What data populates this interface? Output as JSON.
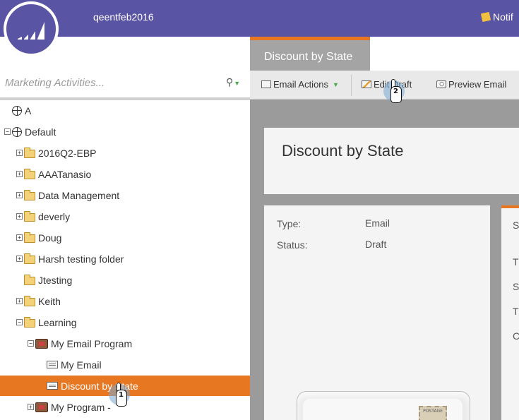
{
  "header": {
    "account_name": "qeentfeb2016",
    "notifications_label": "Notif"
  },
  "search": {
    "placeholder": "Marketing Activities..."
  },
  "tree": {
    "items": [
      {
        "label": "A",
        "icon": "globe-icon"
      },
      {
        "label": "Default",
        "icon": "globe-icon",
        "expander": "minus"
      },
      {
        "label": "2016Q2-EBP",
        "icon": "folder-icon",
        "expander": "plus"
      },
      {
        "label": "AAATanasio",
        "icon": "folder-icon",
        "expander": "plus"
      },
      {
        "label": "Data Management",
        "icon": "folder-icon",
        "expander": "plus"
      },
      {
        "label": "deverly",
        "icon": "folder-icon",
        "expander": "plus"
      },
      {
        "label": "Doug",
        "icon": "folder-icon",
        "expander": "plus"
      },
      {
        "label": "Harsh testing folder",
        "icon": "folder-icon",
        "expander": "plus"
      },
      {
        "label": "Jtesting",
        "icon": "folder-icon"
      },
      {
        "label": "Keith",
        "icon": "folder-icon",
        "expander": "plus"
      },
      {
        "label": "Learning",
        "icon": "folder-icon",
        "expander": "minus"
      },
      {
        "label": "My Email Program",
        "icon": "email-program-icon",
        "expander": "minus"
      },
      {
        "label": "My Email",
        "icon": "email-icon"
      },
      {
        "label": "Discount by State",
        "icon": "email-icon",
        "selected": true
      },
      {
        "label": "My Program -",
        "icon": "program-icon",
        "expander": "plus"
      }
    ]
  },
  "tab": {
    "title": "Discount by State"
  },
  "toolbar": {
    "email_actions": "Email Actions",
    "edit_draft": "Edit Draft",
    "preview_email": "Preview Email"
  },
  "asset": {
    "title": "Discount by State",
    "type_label": "Type:",
    "type_value": "Email",
    "status_label": "Status:",
    "status_value": "Draft"
  },
  "side_card_letters": [
    "S",
    "T",
    "S",
    "T",
    "C"
  ],
  "thumbnail": {
    "stamp_text": "POSTAGE"
  },
  "cursors": [
    {
      "number": "1"
    },
    {
      "number": "2"
    }
  ],
  "colors": {
    "header_purple": "#5a54a4",
    "accent_orange": "#e87722",
    "selection": "#e87722"
  }
}
